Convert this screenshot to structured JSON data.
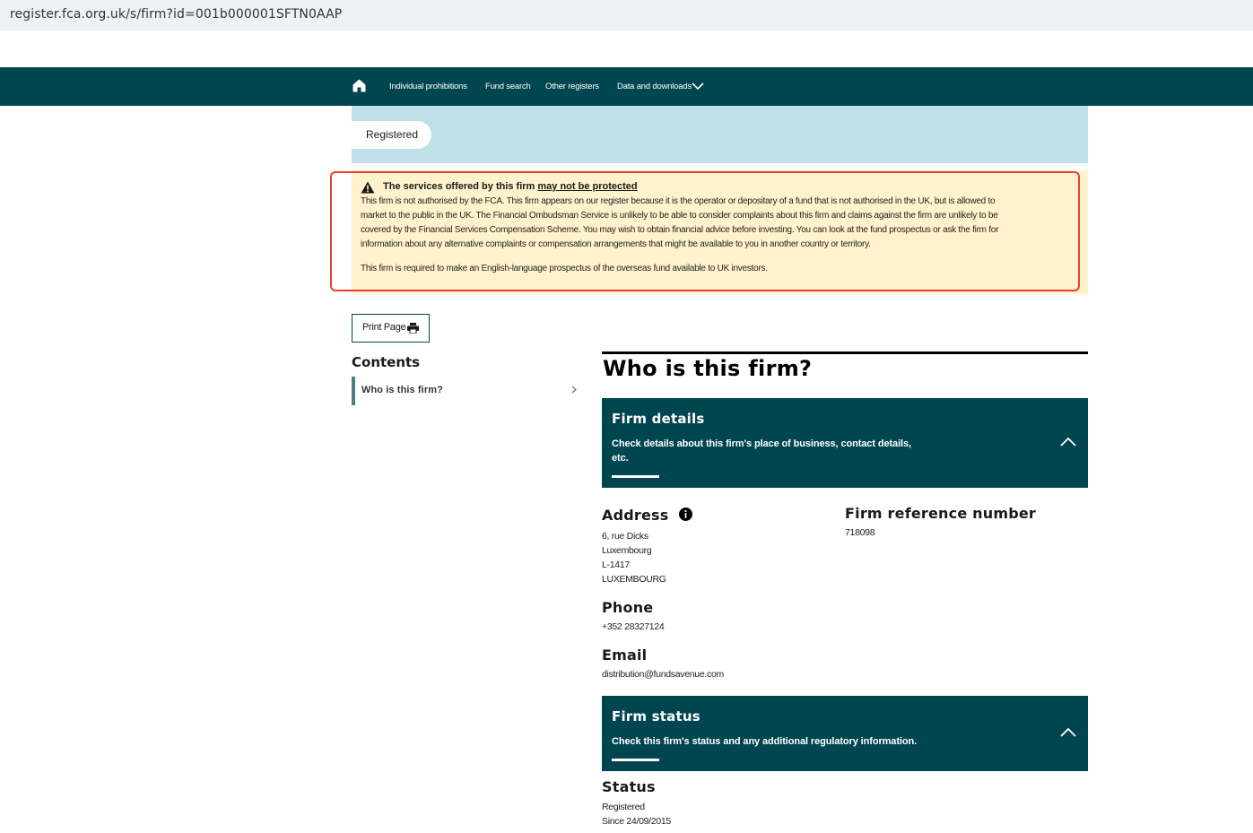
{
  "browser": {
    "url": "register.fca.org.uk/s/firm?id=001b000001SFTN0AAP"
  },
  "nav": {
    "home_icon": "home-icon",
    "items": [
      "Individual prohibitions",
      "Fund search",
      "Other registers",
      "Data and downloads"
    ]
  },
  "banner": {
    "status_label": "Registered"
  },
  "warning": {
    "title_prefix": "The services offered by this firm ",
    "title_link": "may not be protected",
    "para1_lines": [
      "This firm is not authorised by the FCA. This firm appears on our register because it is the operator or depositary of a fund that is not authorised in the UK, but is allowed to",
      "market to the public in the UK. The Financial Ombudsman Service is unlikely to be able to consider complaints about this firm and claims against the firm are unlikely to be",
      "covered by the Financial Services Compensation Scheme. You may wish to obtain financial advice before investing. You can look at the fund prospectus or ask the firm for",
      "information about any alternative complaints or compensation arrangements that might be available to you in another country or territory."
    ],
    "para2": "This firm is required to make an English-language prospectus of the overseas fund available to UK investors."
  },
  "print": {
    "label": "Print Page"
  },
  "contents": {
    "title": "Contents",
    "item": "Who is this firm?"
  },
  "main": {
    "title": "Who is this firm?",
    "firm_details": {
      "title": "Firm details",
      "desc_lines": [
        "Check details about this firm's place of business, contact details,",
        "etc."
      ]
    },
    "address": {
      "heading": "Address",
      "lines": [
        "6, rue Dicks",
        "Luxembourg",
        "L-1417",
        "LUXEMBOURG"
      ]
    },
    "frn": {
      "heading": "Firm reference number",
      "value": "718098"
    },
    "phone": {
      "heading": "Phone",
      "value": "+352 28327124"
    },
    "email": {
      "heading": "Email",
      "value": "distribution@fundsavenue.com"
    },
    "firm_status": {
      "title": "Firm status",
      "desc": "Check this firm's status and any additional regulatory information."
    },
    "status": {
      "heading": "Status",
      "value": "Registered",
      "since": "Since 24/09/2015"
    }
  },
  "colors": {
    "nav_bg": "#004650",
    "banner_bg": "#bfdfe9",
    "warning_bg": "#fff2cc",
    "highlight_border": "#e5412d"
  }
}
